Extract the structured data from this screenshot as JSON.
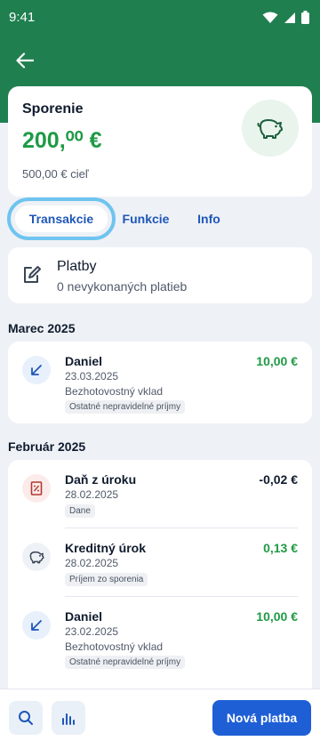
{
  "status_bar": {
    "time": "9:41"
  },
  "account": {
    "name": "Sporenie",
    "balance": "200,⁰⁰ €",
    "goal": "500,00 € cieľ",
    "icon": "piggy-bank-icon"
  },
  "tabs": [
    {
      "label": "Transakcie",
      "active": true
    },
    {
      "label": "Funkcie",
      "active": false
    },
    {
      "label": "Info",
      "active": false
    }
  ],
  "payments": {
    "title": "Platby",
    "subtitle": "0 nevykonaných platieb"
  },
  "months": [
    {
      "label": "Marec 2025",
      "transactions": [
        {
          "name": "Daniel",
          "date": "23.03.2025",
          "type": "Bezhotovostný vklad",
          "badge": "Ostatné nepravidelné príjmy",
          "amount": "10,00 €",
          "icon": "arrow-incoming-icon"
        }
      ]
    },
    {
      "label": "Február 2025",
      "transactions": [
        {
          "name": "Daň z úroku",
          "date": "28.02.2025",
          "type": "",
          "badge": "Dane",
          "amount": "-0,02 €",
          "icon": "tax-document-icon"
        },
        {
          "name": "Kreditný úrok",
          "date": "28.02.2025",
          "type": "",
          "badge": "Príjem zo sporenia",
          "amount": "0,13 €",
          "icon": "piggy-bank-icon"
        },
        {
          "name": "Daniel",
          "date": "23.02.2025",
          "type": "Bezhotovostný vklad",
          "badge": "Ostatné nepravidelné príjmy",
          "amount": "10,00 €",
          "icon": "arrow-incoming-icon"
        }
      ]
    }
  ],
  "bottom_bar": {
    "primary_label": "Nová platba"
  },
  "colors": {
    "brand_green": "#1f7f4f",
    "positive": "#1f9a45",
    "primary_blue": "#1f5fd6",
    "tab_text": "#1f57b8"
  }
}
